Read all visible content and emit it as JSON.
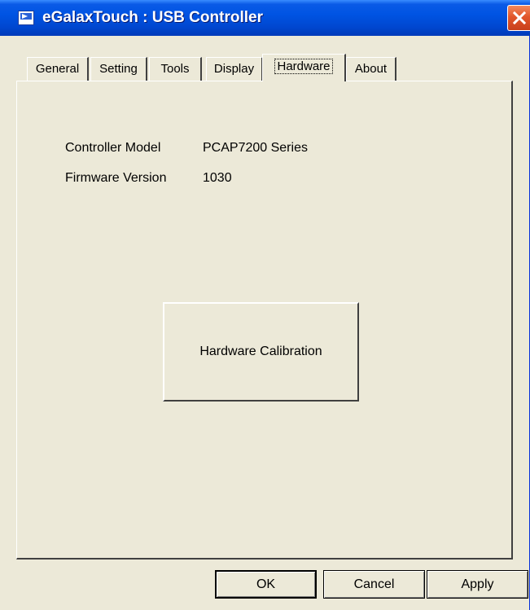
{
  "window": {
    "title": "eGalaxTouch : USB Controller",
    "icon": "app-monitor-icon",
    "close_icon": "close-icon"
  },
  "tabs": [
    {
      "label": "General",
      "selected": false
    },
    {
      "label": "Setting",
      "selected": false
    },
    {
      "label": "Tools",
      "selected": false
    },
    {
      "label": "Display",
      "selected": false
    },
    {
      "label": "Hardware",
      "selected": true
    },
    {
      "label": "About",
      "selected": false
    }
  ],
  "hardware": {
    "controller_model_label": "Controller Model",
    "controller_model_value": "PCAP7200 Series",
    "firmware_version_label": "Firmware Version",
    "firmware_version_value": "1030",
    "calibration_button": "Hardware Calibration"
  },
  "buttons": {
    "ok": "OK",
    "cancel": "Cancel",
    "apply": "Apply"
  },
  "colors": {
    "titlebar": "#0054e3",
    "dialog_face": "#ece9d8",
    "close_button": "#e2562a"
  }
}
